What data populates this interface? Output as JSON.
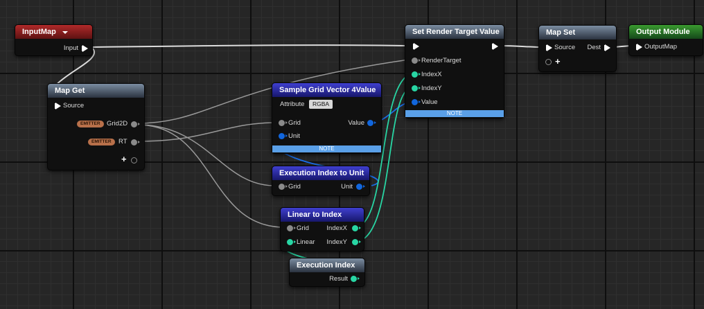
{
  "nodes": {
    "input_map": {
      "title": "InputMap",
      "pins": {
        "input": "Input"
      }
    },
    "map_get": {
      "title": "Map Get",
      "pins": {
        "source": "Source",
        "grid2d": "Grid2D",
        "rt": "RT"
      },
      "badge": "EMITTER"
    },
    "sample_grid": {
      "title": "Sample Grid Vector 4Value",
      "attribute_label": "Attribute",
      "attribute_value": "RGBA",
      "pins": {
        "grid": "Grid",
        "unit": "Unit",
        "value": "Value"
      },
      "note": "NOTE"
    },
    "exec_to_unit": {
      "title": "Execution Index to Unit",
      "pins": {
        "grid": "Grid",
        "unit": "Unit"
      }
    },
    "linear_to_index": {
      "title": "Linear to Index",
      "pins": {
        "grid": "Grid",
        "linear": "Linear",
        "index_x": "IndexX",
        "index_y": "IndexY"
      }
    },
    "exec_index": {
      "title": "Execution Index",
      "pins": {
        "result": "Result"
      }
    },
    "set_rt": {
      "title": "Set Render Target Value",
      "pins": {
        "render_target": "RenderTarget",
        "index_x": "IndexX",
        "index_y": "IndexY",
        "value": "Value"
      },
      "note": "NOTE"
    },
    "map_set": {
      "title": "Map Set",
      "pins": {
        "source": "Source",
        "dest": "Dest"
      }
    },
    "output_module": {
      "title": "Output Module",
      "pins": {
        "output_map": "OutputMap"
      }
    }
  },
  "icons": {
    "exec": "exec-triangle-icon",
    "data": "pin-dot-icon",
    "add": "plus-icon",
    "dropdown": "chevron-down-icon"
  },
  "colors": {
    "header_red": "#a02424",
    "header_gray": "#5c6b7c",
    "header_blue": "#2a2aa6",
    "header_green": "#2f7f29",
    "pin_gray": "#8a8a8a",
    "pin_teal": "#28d6a4",
    "pin_blue": "#1166dd",
    "note_bar": "#5aa0e8",
    "emitter_badge": "#b8704a"
  }
}
